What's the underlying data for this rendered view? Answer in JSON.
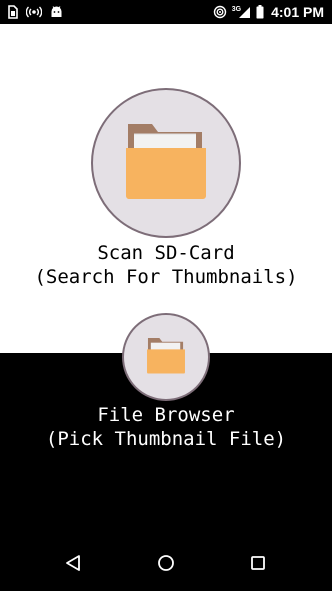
{
  "status_bar": {
    "time": "4:01 PM",
    "network_label": "3G",
    "icons": [
      "sim-card-icon",
      "radio-broadcast-icon",
      "android-icon",
      "cast-icon",
      "signal-icon",
      "battery-icon"
    ]
  },
  "main": {
    "scan_button": {
      "line1": "Scan SD-Card",
      "line2": "(Search For Thumbnails)",
      "icon": "folder-icon"
    },
    "browser_button": {
      "line1": "File Browser",
      "line2": "(Pick Thumbnail File)",
      "icon": "folder-icon"
    }
  },
  "nav_bar": {
    "icons": [
      "back-icon",
      "home-icon",
      "recent-apps-icon"
    ]
  },
  "colors": {
    "folder_front": "#f7b35f",
    "folder_back": "#a37d66",
    "paper": "#f2f2f2",
    "circle_fill": "#e4e0e5",
    "circle_border": "#7d6d78"
  }
}
